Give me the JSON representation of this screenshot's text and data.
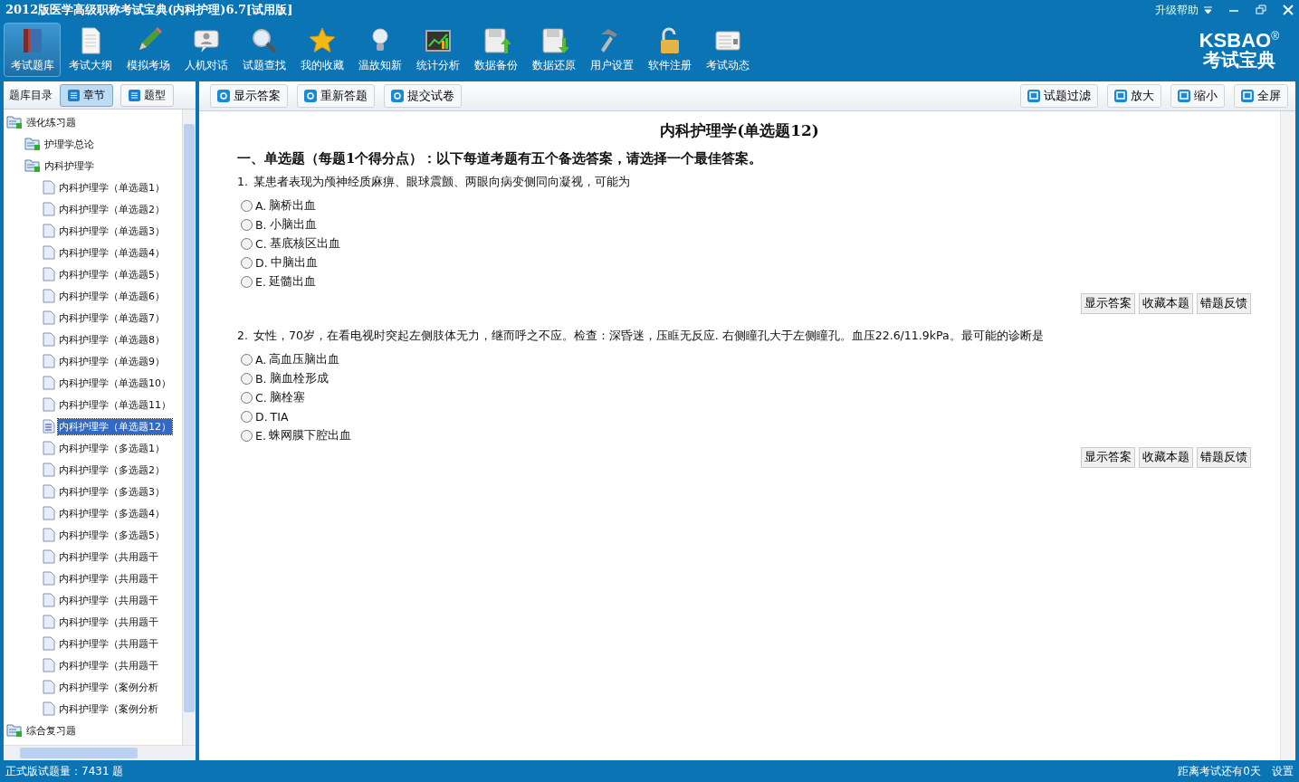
{
  "window": {
    "title": "2012版医学高级职称考试宝典(内科护理)6.7[试用版]",
    "help_menu": "升级帮助"
  },
  "toolbar": [
    {
      "label": "考试题库",
      "selected": true
    },
    {
      "label": "考试大纲",
      "selected": false
    },
    {
      "label": "模拟考场",
      "selected": false
    },
    {
      "label": "人机对话",
      "selected": false
    },
    {
      "label": "试题查找",
      "selected": false
    },
    {
      "label": "我的收藏",
      "selected": false
    },
    {
      "label": "温故知新",
      "selected": false
    },
    {
      "label": "统计分析",
      "selected": false
    },
    {
      "label": "数据备份",
      "selected": false
    },
    {
      "label": "数据还原",
      "selected": false
    },
    {
      "label": "用户设置",
      "selected": false
    },
    {
      "label": "软件注册",
      "selected": false
    },
    {
      "label": "考试动态",
      "selected": false
    }
  ],
  "logo": {
    "text": "KSBAO",
    "mark": "®",
    "subtitle": "考试宝典"
  },
  "sidebar": {
    "heading": "题库目录",
    "tabs": [
      {
        "label": "章节",
        "selected": true
      },
      {
        "label": "题型",
        "selected": false
      }
    ],
    "tree": [
      {
        "label": "强化练习题",
        "kind": "folder",
        "selected": false,
        "children": [
          {
            "label": "护理学总论",
            "kind": "folder",
            "selected": false
          },
          {
            "label": "内科护理学",
            "kind": "folder",
            "selected": false,
            "children": [
              {
                "label": "内科护理学（单选题1）",
                "kind": "page",
                "selected": false
              },
              {
                "label": "内科护理学（单选题2）",
                "kind": "page",
                "selected": false
              },
              {
                "label": "内科护理学（单选题3）",
                "kind": "page",
                "selected": false
              },
              {
                "label": "内科护理学（单选题4）",
                "kind": "page",
                "selected": false
              },
              {
                "label": "内科护理学（单选题5）",
                "kind": "page",
                "selected": false
              },
              {
                "label": "内科护理学（单选题6）",
                "kind": "page",
                "selected": false
              },
              {
                "label": "内科护理学（单选题7）",
                "kind": "page",
                "selected": false
              },
              {
                "label": "内科护理学（单选题8）",
                "kind": "page",
                "selected": false
              },
              {
                "label": "内科护理学（单选题9）",
                "kind": "page",
                "selected": false
              },
              {
                "label": "内科护理学（单选题10）",
                "kind": "page",
                "selected": false
              },
              {
                "label": "内科护理学（单选题11）",
                "kind": "page",
                "selected": false
              },
              {
                "label": "内科护理学（单选题12）",
                "kind": "page",
                "selected": true
              },
              {
                "label": "内科护理学（多选题1）",
                "kind": "page",
                "selected": false
              },
              {
                "label": "内科护理学（多选题2）",
                "kind": "page",
                "selected": false
              },
              {
                "label": "内科护理学（多选题3）",
                "kind": "page",
                "selected": false
              },
              {
                "label": "内科护理学（多选题4）",
                "kind": "page",
                "selected": false
              },
              {
                "label": "内科护理学（多选题5）",
                "kind": "page",
                "selected": false
              },
              {
                "label": "内科护理学（共用题干",
                "kind": "page",
                "selected": false
              },
              {
                "label": "内科护理学（共用题干",
                "kind": "page",
                "selected": false
              },
              {
                "label": "内科护理学（共用题干",
                "kind": "page",
                "selected": false
              },
              {
                "label": "内科护理学（共用题干",
                "kind": "page",
                "selected": false
              },
              {
                "label": "内科护理学（共用题干",
                "kind": "page",
                "selected": false
              },
              {
                "label": "内科护理学（共用题干",
                "kind": "page",
                "selected": false
              },
              {
                "label": "内科护理学（案例分析",
                "kind": "page",
                "selected": false
              },
              {
                "label": "内科护理学（案例分析",
                "kind": "page",
                "selected": false
              }
            ]
          }
        ]
      },
      {
        "label": "综合复习题",
        "kind": "folder",
        "selected": false
      }
    ]
  },
  "actions": [
    "显示答案",
    "重新答题",
    "提交试卷"
  ],
  "view_actions": [
    "试题过滤",
    "放大",
    "缩小",
    "全屏"
  ],
  "content": {
    "title": "内科护理学(单选题12)",
    "section": "一、单选题（每题1个得分点）：以下每道考题有五个备选答案，请选择一个最佳答案。",
    "questions": [
      {
        "number": "1.",
        "text": "某患者表现为颅神经质麻痹、眼球震颤、两眼向病变侧同向凝视，可能为",
        "options": [
          {
            "letter": "A.",
            "text": "脑桥出血",
            "selected": false
          },
          {
            "letter": "B.",
            "text": "小脑出血",
            "selected": false
          },
          {
            "letter": "C.",
            "text": "基底核区出血",
            "selected": false
          },
          {
            "letter": "D.",
            "text": "中脑出血",
            "selected": false
          },
          {
            "letter": "E.",
            "text": "延髓出血",
            "selected": false
          }
        ],
        "buttons": [
          "显示答案",
          "收藏本题",
          "错题反馈"
        ]
      },
      {
        "number": "2.",
        "text": "女性，70岁，在看电视时突起左侧肢体无力，继而呼之不应。检查：深昏迷，压眶无反应. 右侧瞳孔大于左侧瞳孔。血压22.6/11.9kPa。最可能的诊断是",
        "options": [
          {
            "letter": "A.",
            "text": "高血压脑出血",
            "selected": false
          },
          {
            "letter": "B.",
            "text": "脑血栓形成",
            "selected": false
          },
          {
            "letter": "C.",
            "text": "脑栓塞",
            "selected": false
          },
          {
            "letter": "D.",
            "text": "TIA",
            "selected": false
          },
          {
            "letter": "E.",
            "text": "蛛网膜下腔出血",
            "selected": false
          }
        ],
        "buttons": [
          "显示答案",
          "收藏本题",
          "错题反馈"
        ]
      }
    ]
  },
  "status_bar": {
    "count": "正式版试题量：7431 题",
    "countdown": "距离考试还有0天",
    "settings": "设置"
  }
}
